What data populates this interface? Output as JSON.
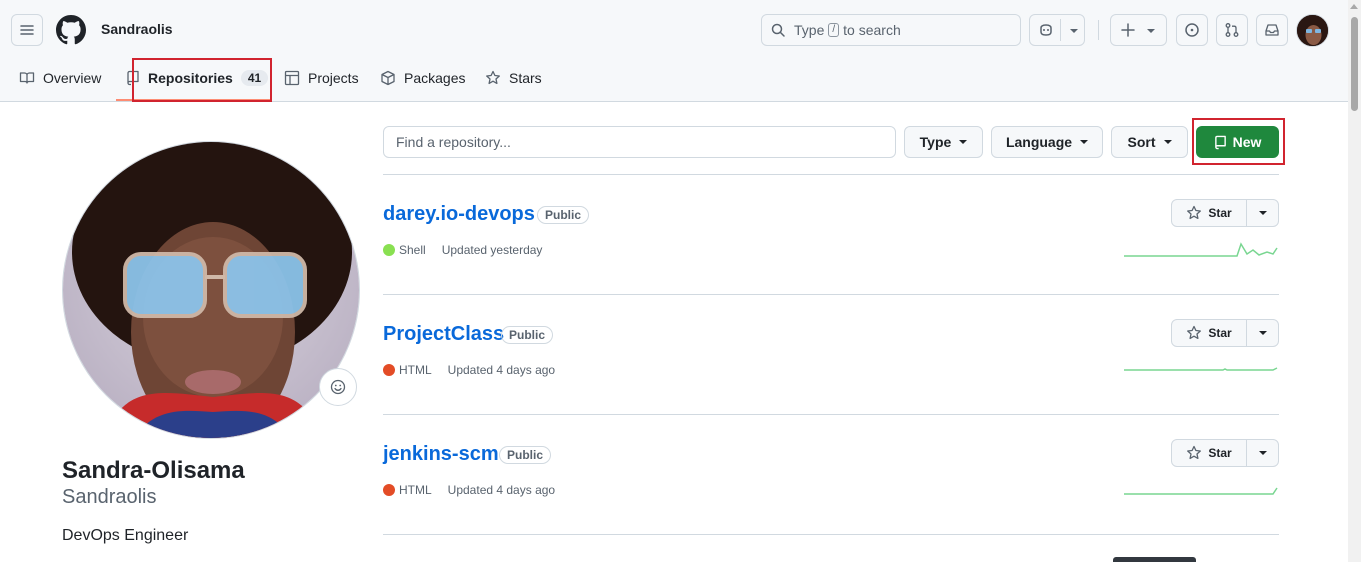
{
  "header": {
    "username": "Sandraolis",
    "search_prefix": "Type",
    "search_key": "/",
    "search_suffix": "to search"
  },
  "tabs": [
    {
      "label": "Overview"
    },
    {
      "label": "Repositories",
      "count": "41"
    },
    {
      "label": "Projects"
    },
    {
      "label": "Packages"
    },
    {
      "label": "Stars"
    }
  ],
  "profile": {
    "full_name": "Sandra-Olisama",
    "login": "Sandraolis",
    "bio": "DevOps Engineer"
  },
  "toolbar": {
    "find_placeholder": "Find a repository...",
    "type_label": "Type",
    "language_label": "Language",
    "sort_label": "Sort",
    "new_label": "New"
  },
  "repos": [
    {
      "name": "darey.io-devops",
      "visibility": "Public",
      "language": "Shell",
      "language_color": "#89e051",
      "updated": "Updated yesterday",
      "star_label": "Star"
    },
    {
      "name": "ProjectClass",
      "visibility": "Public",
      "language": "HTML",
      "language_color": "#e34c26",
      "updated": "Updated 4 days ago",
      "star_label": "Star"
    },
    {
      "name": "jenkins-scm",
      "visibility": "Public",
      "language": "HTML",
      "language_color": "#e34c26",
      "updated": "Updated 4 days ago",
      "star_label": "Star"
    }
  ],
  "colors": {
    "accent_green": "#1f883d",
    "link_blue": "#0969da",
    "highlight_red": "#d1242f",
    "tab_underline": "#fd8c73"
  },
  "icons": [
    "hamburger-menu-icon",
    "github-logo",
    "search-icon",
    "copilot-icon",
    "plus-icon",
    "issues-icon",
    "pull-requests-icon",
    "inbox-icon",
    "book-icon",
    "repo-icon",
    "table-icon",
    "package-icon",
    "star-icon",
    "smiley-icon"
  ]
}
